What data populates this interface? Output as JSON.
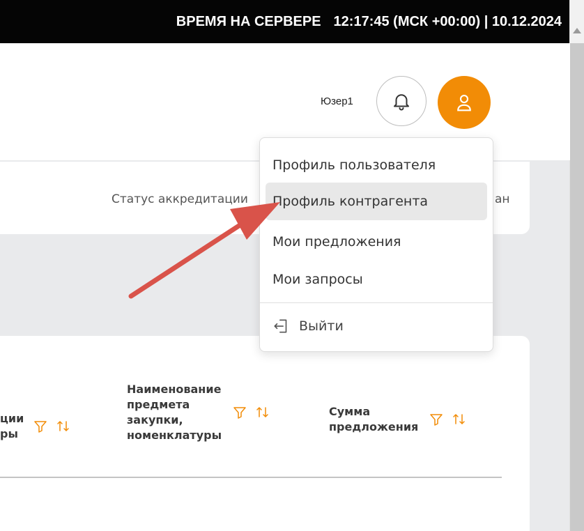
{
  "topbar": {
    "label": "ВРЕМЯ НА СЕРВЕРЕ",
    "time": "12:17:45 (МСК +00:00) | 10.12.2024"
  },
  "header": {
    "user_name": "Юзер1",
    "bell_icon": "bell-icon",
    "avatar_icon": "user-icon",
    "accent_color": "#f28c06"
  },
  "status": {
    "text": "Статус аккредитации",
    "tail": "ан"
  },
  "menu": {
    "items": [
      {
        "label": "Профиль пользователя"
      },
      {
        "label": "Профиль контрагента"
      },
      {
        "label": "Мои предложения"
      },
      {
        "label": "Мои запросы"
      }
    ],
    "logout_label": "Выйти",
    "logout_icon": "logout-icon"
  },
  "table": {
    "columns": [
      {
        "label": "ции\nры"
      },
      {
        "label": "Наименование\nпредмета\nзакупки,\nноменклатуры"
      },
      {
        "label": "Сумма\nпредложения"
      }
    ],
    "filter_icon": "filter-icon",
    "sort_icon": "sort-icon"
  },
  "annotation": {
    "arrow_color": "#d9534a"
  }
}
